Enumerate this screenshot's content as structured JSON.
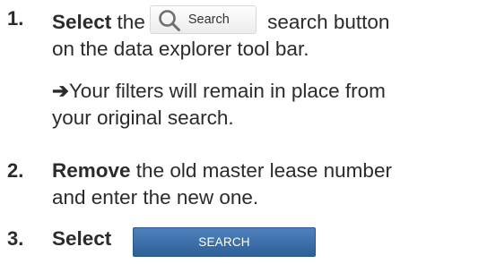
{
  "steps": [
    {
      "number": "1.",
      "verb": "Select",
      "text_before": " the",
      "inline_button_label": "Search",
      "text_after_line1": " search button",
      "text_line2": "on the data explorer tool bar.",
      "note_arrow": "➔",
      "note_line1": "Your filters will remain in place from",
      "note_line2": "your original search."
    },
    {
      "number": "2.",
      "verb": "Remove",
      "text_line1": " the old master lease number",
      "text_line2": "and enter the new one."
    },
    {
      "number": "3.",
      "verb": "Select",
      "button_label": "SEARCH"
    }
  ],
  "colors": {
    "text": "#2b2b2b",
    "search_button_bg": "#3b6da8",
    "search_button_text": "#ffffff"
  },
  "icons": {
    "inline_search": "magnifier-icon"
  }
}
